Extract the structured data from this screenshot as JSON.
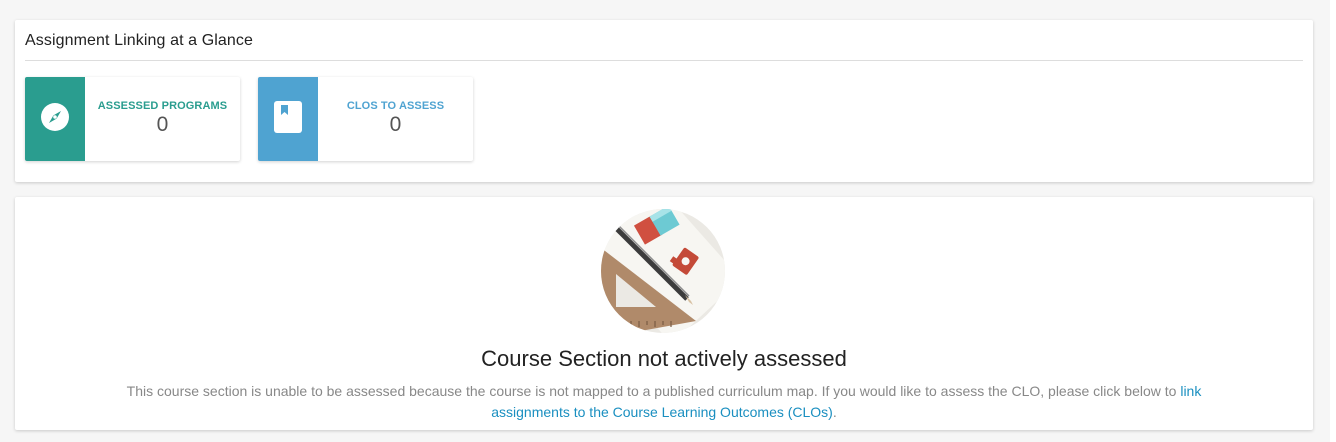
{
  "glance": {
    "title": "Assignment Linking at a Glance",
    "tiles": [
      {
        "label": "ASSESSED PROGRAMS",
        "value": "0",
        "icon": "compass-icon",
        "color": "#2a9d8f"
      },
      {
        "label": "CLOS TO ASSESS",
        "value": "0",
        "icon": "bookmark-book-icon",
        "color": "#4fa3d1"
      }
    ]
  },
  "status": {
    "heading": "Course Section not actively assessed",
    "description_before": "This course section is unable to be assessed because the course is not mapped to a published curriculum map. If you would like to assess the CLO, please click below to ",
    "link_text": "link assignments to the Course Learning Outcomes (CLOs)",
    "description_after": "."
  },
  "colors": {
    "programs_accent": "#2a9d8f",
    "clos_accent": "#4fa3d1",
    "link": "#1a8fc0"
  }
}
